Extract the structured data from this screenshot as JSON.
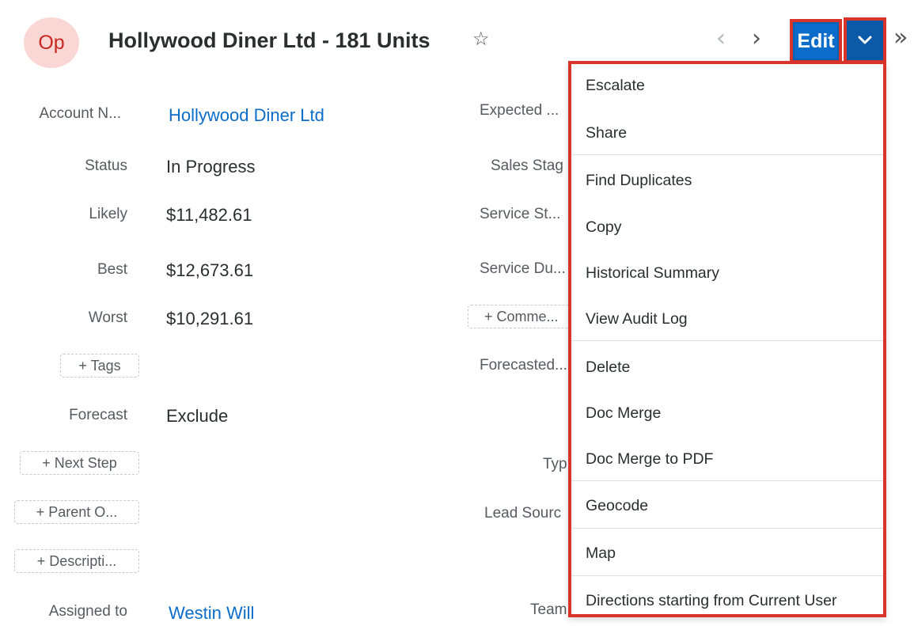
{
  "header": {
    "avatar_text": "Op",
    "title": "Hollywood Diner Ltd - 181 Units",
    "edit_label": "Edit"
  },
  "left_fields": [
    {
      "label": "Account N...",
      "value": "Hollywood Diner Ltd"
    },
    {
      "label": "Status",
      "value": "In Progress"
    },
    {
      "label": "Likely",
      "value": "$11,482.61"
    },
    {
      "label": "Best",
      "value": "$12,673.61"
    },
    {
      "label": "Worst",
      "value": "$10,291.61"
    },
    {
      "label": "Forecast",
      "value": "Exclude"
    },
    {
      "label": "Assigned to",
      "value": "Westin Will"
    }
  ],
  "left_pills": {
    "tags": "+ Tags",
    "next_step": "+ Next Step",
    "parent": "+ Parent O...",
    "description": "+ Descripti..."
  },
  "right_labels": {
    "expected": "Expected ...",
    "sales_stage": "Sales Stag",
    "service_start": "Service St...",
    "service_duration": "Service Du...",
    "comments": "+ Comme...",
    "forecasted": "Forecasted...",
    "type": "Typ",
    "lead_source": "Lead Sourc",
    "teams": "Team"
  },
  "menu": {
    "items": [
      "Escalate",
      "Share",
      "Find Duplicates",
      "Copy",
      "Historical Summary",
      "View Audit Log",
      "Delete",
      "Doc Merge",
      "Doc Merge to PDF",
      "Geocode",
      "Map",
      "Directions starting from Current User"
    ]
  },
  "colors": {
    "brand_blue": "#0b6dc9",
    "highlight_red": "#d9342b",
    "avatar_bg": "#fad7d4",
    "avatar_text": "#c8281e"
  }
}
